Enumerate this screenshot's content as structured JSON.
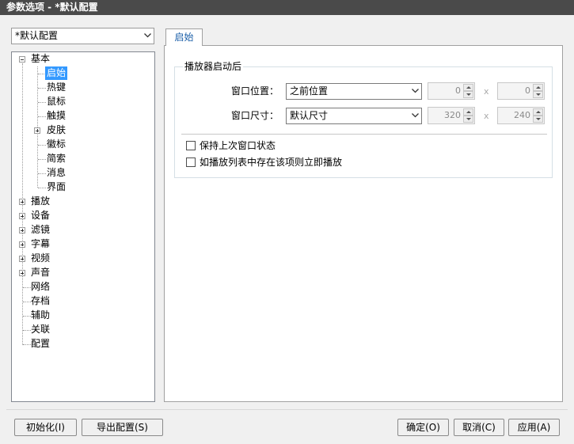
{
  "window": {
    "title": "参数选项 - *默认配置"
  },
  "profile_select": {
    "value": "*默认配置"
  },
  "tree": {
    "basic": {
      "label": "基本",
      "children": [
        "启始",
        "热键",
        "鼠标",
        "触摸",
        "皮肤",
        "徽标",
        "简索",
        "消息",
        "界面"
      ]
    },
    "top": [
      "播放",
      "设备",
      "滤镜",
      "字幕",
      "视频",
      "声音",
      "网络",
      "存档",
      "辅助",
      "关联",
      "配置"
    ],
    "selected": "启始"
  },
  "tab": {
    "label": "启始"
  },
  "group": {
    "title": "播放器启动后",
    "position_label": "窗口位置：",
    "position_value": "之前位置",
    "pos_x": "0",
    "pos_y": "0",
    "size_label": "窗口尺寸：",
    "size_value": "默认尺寸",
    "size_w": "320",
    "size_h": "240",
    "separator": "x"
  },
  "options": {
    "keep_state": "保持上次窗口状态",
    "play_if_in_list": "如播放列表中存在该项则立即播放"
  },
  "buttons": {
    "reset": "初始化(I)",
    "export": "导出配置(S)",
    "ok": "确定(O)",
    "cancel": "取消(C)",
    "apply": "应用(A)"
  },
  "colors": {
    "selection": "#3399ff",
    "titlebar": "#4a4a4a",
    "tab_text": "#1b5fa8"
  }
}
